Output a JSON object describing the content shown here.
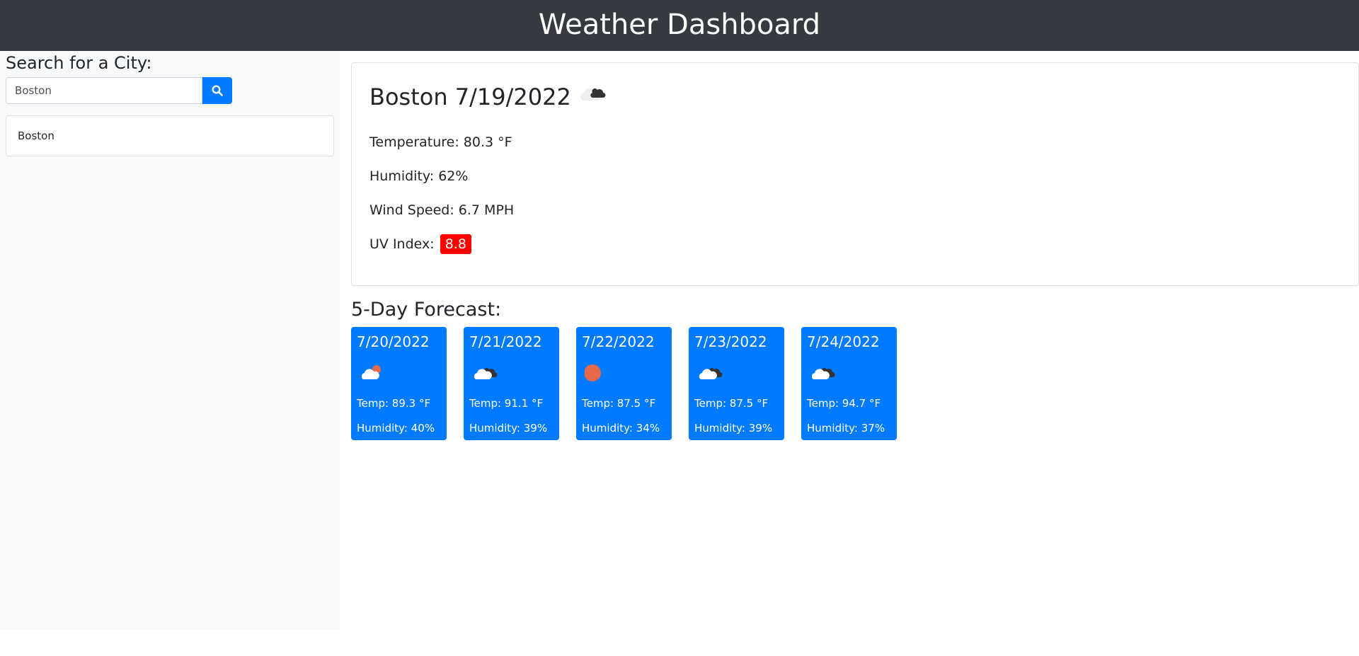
{
  "header": {
    "title": "Weather Dashboard"
  },
  "search": {
    "title": "Search for a City:",
    "value": "Boston",
    "button_icon": "search-icon"
  },
  "history": {
    "items": [
      "Boston"
    ]
  },
  "current": {
    "title": "Boston 7/19/2022",
    "icon": "broken-clouds-icon",
    "temperature": "Temperature: 80.3 °F",
    "humidity": "Humidity: 62%",
    "wind": "Wind Speed: 6.7 MPH",
    "uv_label": "UV Index:",
    "uv_value": "8.8",
    "uv_color": "#ff0000"
  },
  "forecast": {
    "title": "5-Day Forecast:",
    "days": [
      {
        "date": "7/20/2022",
        "icon": "few-clouds-icon",
        "temp": "Temp: 89.3 °F",
        "humidity": "Humidity: 40%"
      },
      {
        "date": "7/21/2022",
        "icon": "broken-clouds-icon",
        "temp": "Temp: 91.1 °F",
        "humidity": "Humidity: 39%"
      },
      {
        "date": "7/22/2022",
        "icon": "clear-sky-icon",
        "temp": "Temp: 87.5 °F",
        "humidity": "Humidity: 34%"
      },
      {
        "date": "7/23/2022",
        "icon": "broken-clouds-icon",
        "temp": "Temp: 87.5 °F",
        "humidity": "Humidity: 39%"
      },
      {
        "date": "7/24/2022",
        "icon": "broken-clouds-icon",
        "temp": "Temp: 94.7 °F",
        "humidity": "Humidity: 37%"
      }
    ]
  },
  "colors": {
    "header_bg": "#343a40",
    "accent": "#007bff",
    "uv_high": "#ff0000"
  }
}
